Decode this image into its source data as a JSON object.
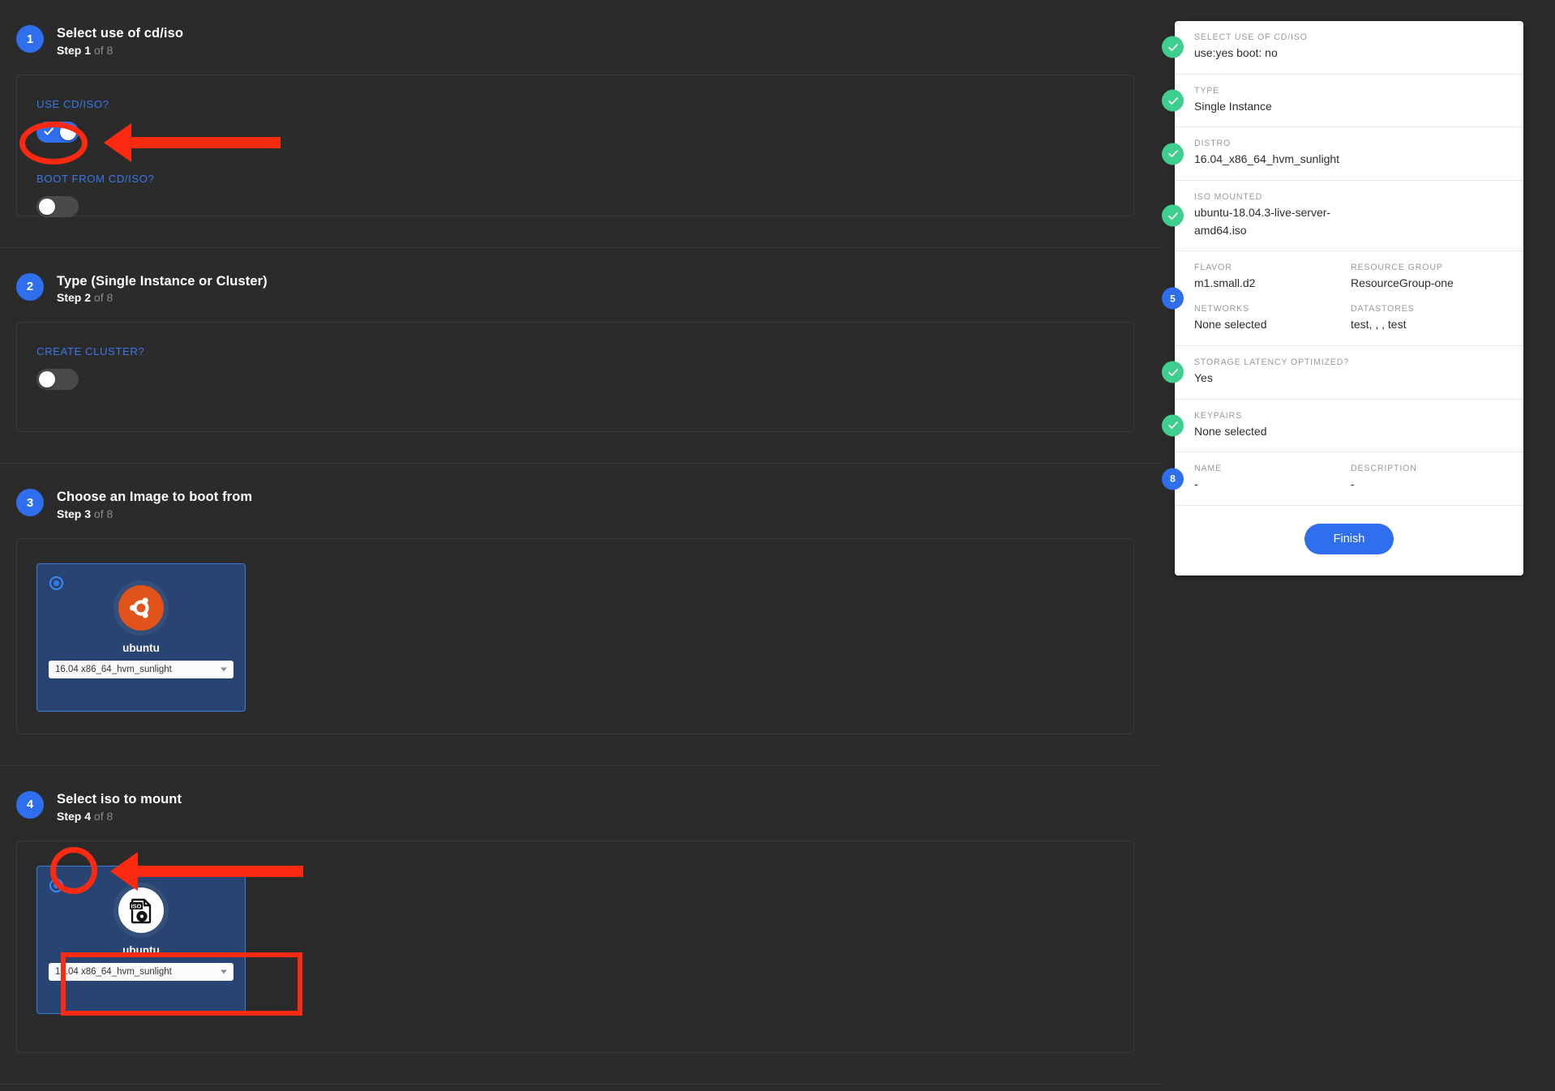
{
  "theme": {
    "bg": "#2b2b2b",
    "accent_blue": "#2f6fed",
    "card_blue": "#284472",
    "annotation_red": "#fb2a10",
    "check_green": "#3ecf8e"
  },
  "wizard": {
    "steps": [
      {
        "number": "1",
        "title": "Select use of cd/iso",
        "step_prefix": "Step 1",
        "step_suffix": "of 8",
        "fields": [
          {
            "label": "USE CD/ISO?",
            "toggle_state": "on"
          },
          {
            "label": "BOOT FROM CD/ISO?",
            "toggle_state": "off"
          }
        ]
      },
      {
        "number": "2",
        "title": "Type (Single Instance or Cluster)",
        "step_prefix": "Step 2",
        "step_suffix": "of 8",
        "fields": [
          {
            "label": "CREATE CLUSTER?",
            "toggle_state": "off"
          }
        ]
      },
      {
        "number": "3",
        "title": "Choose an Image to boot from",
        "step_prefix": "Step 3",
        "step_suffix": "of 8",
        "card": {
          "icon": "ubuntu-logo-icon",
          "name": "ubuntu",
          "selected": true,
          "select_value": "16.04 x86_64_hvm_sunlight"
        }
      },
      {
        "number": "4",
        "title": "Select iso to mount",
        "step_prefix": "Step 4",
        "step_suffix": "of 8",
        "card": {
          "icon": "iso-file-icon",
          "name": "ubuntu",
          "selected": true,
          "select_value": "18.04 x86_64_hvm_sunlight"
        }
      }
    ]
  },
  "summary": {
    "rows": [
      {
        "marker": "check",
        "marker_label": "",
        "blocks": [
          {
            "cols": [
              {
                "label": "SELECT USE OF CD/ISO",
                "value": "use:yes boot: no"
              }
            ]
          }
        ]
      },
      {
        "marker": "check",
        "marker_label": "",
        "blocks": [
          {
            "cols": [
              {
                "label": "TYPE",
                "value": "Single Instance"
              }
            ]
          }
        ]
      },
      {
        "marker": "check",
        "marker_label": "",
        "blocks": [
          {
            "cols": [
              {
                "label": "DISTRO",
                "value": "16.04_x86_64_hvm_sunlight"
              }
            ]
          }
        ]
      },
      {
        "marker": "check",
        "marker_label": "",
        "blocks": [
          {
            "cols": [
              {
                "label": "ISO MOUNTED",
                "value": "ubuntu-18.04.3-live-server-\namd64.iso"
              }
            ]
          }
        ]
      },
      {
        "marker": "number",
        "marker_label": "5",
        "blocks": [
          {
            "cols": [
              {
                "label": "FLAVOR",
                "value": "m1.small.d2"
              },
              {
                "label": "RESOURCE GROUP",
                "value": "ResourceGroup-one"
              }
            ]
          },
          {
            "cols": [
              {
                "label": "NETWORKS",
                "value": "None selected"
              },
              {
                "label": "DATASTORES",
                "value": "test, , , test"
              }
            ]
          }
        ]
      },
      {
        "marker": "check",
        "marker_label": "",
        "blocks": [
          {
            "cols": [
              {
                "label": "STORAGE LATENCY OPTIMIZED?",
                "value": "Yes"
              }
            ]
          }
        ]
      },
      {
        "marker": "check",
        "marker_label": "",
        "blocks": [
          {
            "cols": [
              {
                "label": "KEYPAIRS",
                "value": "None selected"
              }
            ]
          }
        ]
      },
      {
        "marker": "number",
        "marker_label": "8",
        "blocks": [
          {
            "cols": [
              {
                "label": "NAME",
                "value": "-"
              },
              {
                "label": "DESCRIPTION",
                "value": "-"
              }
            ]
          }
        ]
      }
    ],
    "finish_label": "Finish"
  }
}
